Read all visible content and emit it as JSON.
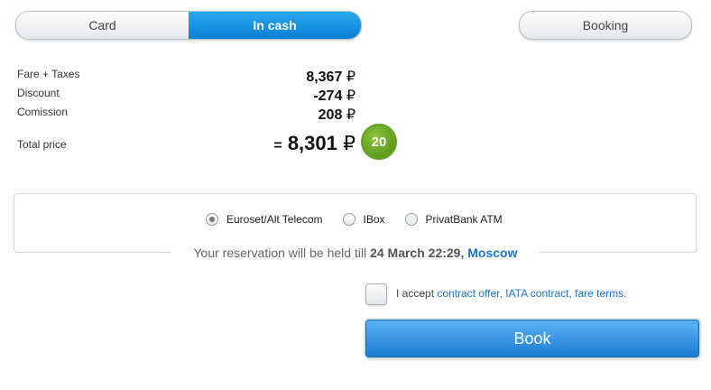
{
  "payment_tabs": {
    "card": "Card",
    "in_cash": "In cash"
  },
  "booking_label": "Booking",
  "price": {
    "fare_label": "Fare + Taxes",
    "fare_value": "8,367",
    "discount_label": "Discount",
    "discount_value": "-274",
    "commission_label": "Comission",
    "commission_value": "208",
    "total_label": "Total price",
    "total_eq": "=",
    "total_value": "8,301",
    "currency": "₽",
    "badge": "20"
  },
  "methods": [
    {
      "label": "Euroset/Alt Telecom",
      "selected": true
    },
    {
      "label": "IBox",
      "selected": false
    },
    {
      "label": "PrivatBank ATM",
      "selected": false
    }
  ],
  "reservation": {
    "prefix": "Your reservation will be held till",
    "date": "24 March 22:29,",
    "city": "Moscow"
  },
  "terms": {
    "prefix": "I accept",
    "contract_offer": "contract offer,",
    "iata_contract": "IATA contract,",
    "fare_terms": "fare terms."
  },
  "book_label": "Book",
  "colors": {
    "accent": "#1a7cd4",
    "badge": "#5e9d1c",
    "link": "#1a73c7"
  }
}
